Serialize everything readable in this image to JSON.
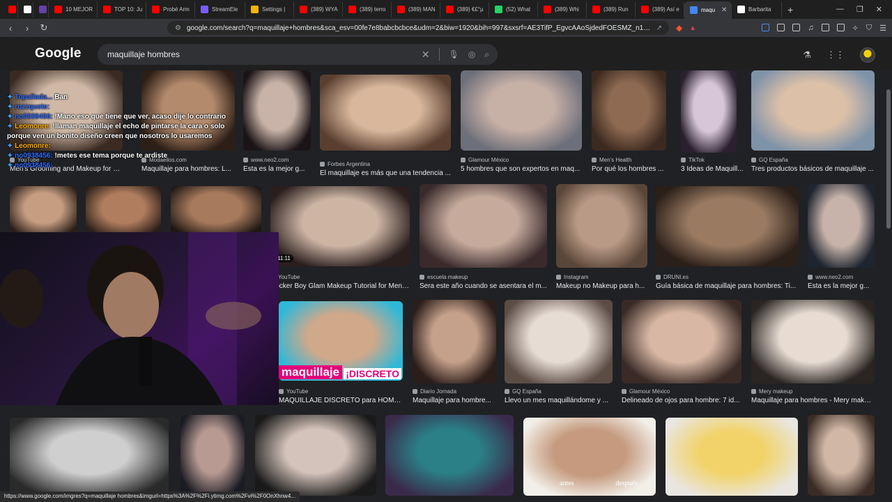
{
  "tabs": [
    {
      "label": "",
      "color": "#ff0000"
    },
    {
      "label": "",
      "color": "#ffffff"
    },
    {
      "label": "",
      "color": "#6441a5"
    },
    {
      "label": "10 MEJOR",
      "color": "#ff0000"
    },
    {
      "label": "TOP 10: Ju",
      "color": "#ff0000"
    },
    {
      "label": "Probé Arm",
      "color": "#ff0000"
    },
    {
      "label": "StreamEle",
      "color": "#7a5cff"
    },
    {
      "label": "Settings |",
      "color": "#f5b400"
    },
    {
      "label": "(389) WYA",
      "color": "#ff0000"
    },
    {
      "label": "(389) terro",
      "color": "#ff0000"
    },
    {
      "label": "(389) MAN",
      "color": "#ff0000"
    },
    {
      "label": "(389) €£°µ",
      "color": "#ff0000"
    },
    {
      "label": "(52) What",
      "color": "#25d366"
    },
    {
      "label": "(389) Whi",
      "color": "#ff0000"
    },
    {
      "label": "(389) Run",
      "color": "#ff0000"
    },
    {
      "label": "(389) Así e",
      "color": "#ff0000"
    },
    {
      "label": "maqu",
      "color": "#4285f4",
      "active": true
    },
    {
      "label": "Barbarita",
      "color": "#ffffff"
    }
  ],
  "address_bar": {
    "url": "google.com/search?q=maquillaje+hombres&sca_esv=00fe7e8babcbcbce&udm=2&biw=1920&bih=997&sxsrf=AE3TifP_EgvcAAoSjdedFOESMZ_n1F..."
  },
  "google": {
    "logo": "Google",
    "query": "maquillaje hombres"
  },
  "results": [
    {
      "source": "YouTube",
      "title": "Men's Grooming and Makeup for Men..."
    },
    {
      "source": "Modaellos.com",
      "title": "Maquillaje para hombres: L..."
    },
    {
      "source": "www.neo2.com",
      "title": "Esta es la mejor g..."
    },
    {
      "source": "Forbes Argentina",
      "title": "El maquillaje es más que una tendencia ..."
    },
    {
      "source": "Glamour México",
      "title": "5 hombres que son expertos en maq..."
    },
    {
      "source": "Men's Health",
      "title": "Por qué los hombres ..."
    },
    {
      "source": "TikTok",
      "title": "3 Ideas de Maquill..."
    },
    {
      "source": "GQ España",
      "title": "Tres productos básicos de maquillaje ..."
    },
    {
      "source": "YouTube",
      "title": "Rocker Boy Glam Makeup Tutorial for Men ...",
      "badge": "11:11"
    },
    {
      "source": "escuela makeup",
      "title": "Sera este año cuando se asentara el m..."
    },
    {
      "source": "Instagram",
      "title": "Makeup no Makeup para h..."
    },
    {
      "source": "DRUNI.es",
      "title": "Guía básica de maquillaje para hombres: Ti..."
    },
    {
      "source": "www.neo2.com",
      "title": "Esta es la mejor g..."
    },
    {
      "source": "YouTube",
      "title": "MAQUILLAJE DISCRETO para HOMBR...",
      "overlay": "maquillaje",
      "overlay2": "¡DISCRETO"
    },
    {
      "source": "Diario Jornada",
      "title": "Maquillaje para hombre..."
    },
    {
      "source": "GQ España",
      "title": "Llevo un mes maquillándome y ..."
    },
    {
      "source": "Glamour México",
      "title": "Delineado de ojos para hombre: 7 id..."
    },
    {
      "source": "Mery makeup",
      "title": "Maquillaje para hombres - Mery makeup"
    },
    {
      "overlay": "antes",
      "overlay2": "después"
    }
  ],
  "chat": [
    {
      "user": "Topallada...",
      "msg": "Ban"
    },
    {
      "user": "rozzquete:",
      "msg": ""
    },
    {
      "user": "no0938456:",
      "msg": "!Mano eso que tiene que ver, acaso dije lo contrario"
    },
    {
      "user": "Leomonre:",
      "msg": "!llaman maquillaje el echo de pintarse la cara o solo"
    },
    {
      "user": "",
      "msg": "porque ven un bonito diseño creen que nosotros lo usaremos"
    },
    {
      "user": "Leomonre:",
      "msg": ""
    },
    {
      "user": "no0938456:",
      "msg": "!metes ese tema porque te ardiste"
    },
    {
      "user": "no0938456:",
      "msg": ""
    }
  ],
  "status_bar": "https://www.google.com/imgres?q=maquillaje hombres&imgurl=https%3A%2F%2Fi.ytimg.com%2Fvi%2F0OnXhnw4...",
  "colors": {
    "page_bg": "#202124",
    "accent": "#8ab4f8"
  }
}
